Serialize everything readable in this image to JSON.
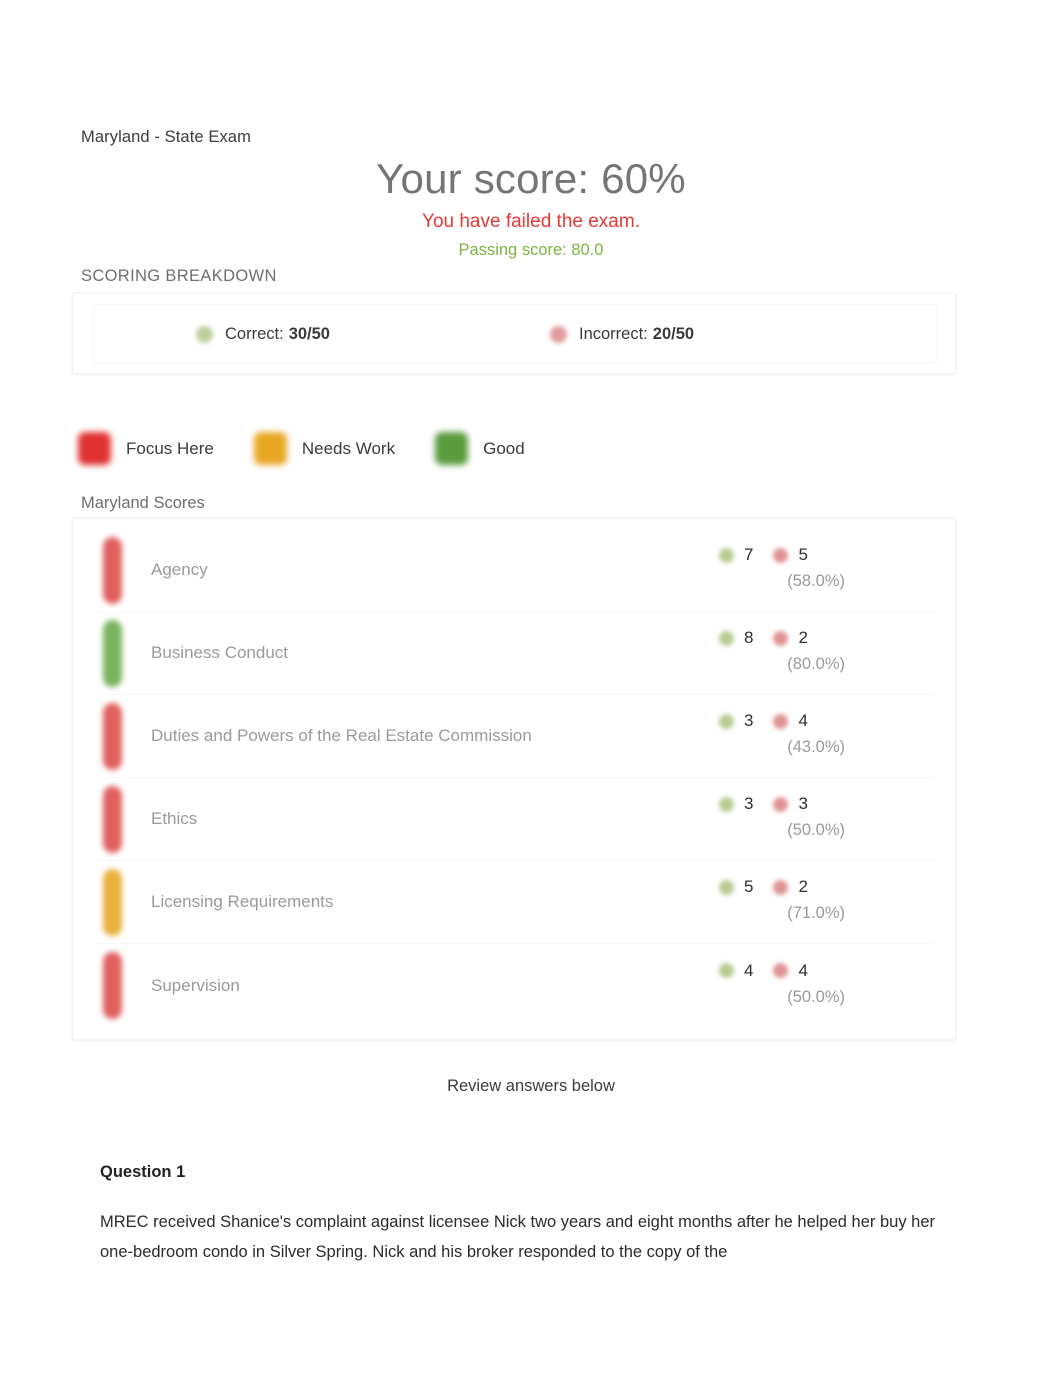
{
  "header": {
    "exam_name": "Maryland - State Exam",
    "score_title": "Your score: 60%",
    "result_message": "You have failed the exam.",
    "passing_score": "Passing score: 80.0"
  },
  "breakdown": {
    "section_label": "SCORING BREAKDOWN",
    "correct_label": "Correct:",
    "correct_value": "30/50",
    "incorrect_label": "Incorrect:",
    "incorrect_value": "20/50",
    "correct_color": "#8aa84a",
    "incorrect_color": "#c94a4a"
  },
  "legend": {
    "items": [
      {
        "label": "Focus Here",
        "color": "#e03131"
      },
      {
        "label": "Needs Work",
        "color": "#e8a723"
      },
      {
        "label": "Good",
        "color": "#5a9b3e"
      }
    ]
  },
  "scores": {
    "section_label": "Maryland Scores",
    "rows": [
      {
        "name": "Agency",
        "correct": "7",
        "incorrect": "5",
        "percent": "(58.0%)",
        "status_color": "#e0605f"
      },
      {
        "name": "Business Conduct",
        "correct": "8",
        "incorrect": "2",
        "percent": "(80.0%)",
        "status_color": "#79b35c"
      },
      {
        "name": "Duties and Powers of the Real Estate Commission",
        "correct": "3",
        "incorrect": "4",
        "percent": "(43.0%)",
        "status_color": "#e0605f"
      },
      {
        "name": "Ethics",
        "correct": "3",
        "incorrect": "3",
        "percent": "(50.0%)",
        "status_color": "#e0605f"
      },
      {
        "name": "Licensing Requirements",
        "correct": "5",
        "incorrect": "2",
        "percent": "(71.0%)",
        "status_color": "#e8b13c"
      },
      {
        "name": "Supervision",
        "correct": "4",
        "incorrect": "4",
        "percent": "(50.0%)",
        "status_color": "#e0605f"
      }
    ]
  },
  "review": {
    "note": "Review answers below",
    "question_number": "Question 1",
    "question_text": "MREC received Shanice's complaint against licensee Nick two years and eight months after he helped her buy her one-bedroom condo in Silver Spring. Nick and his broker responded to the copy of the"
  }
}
